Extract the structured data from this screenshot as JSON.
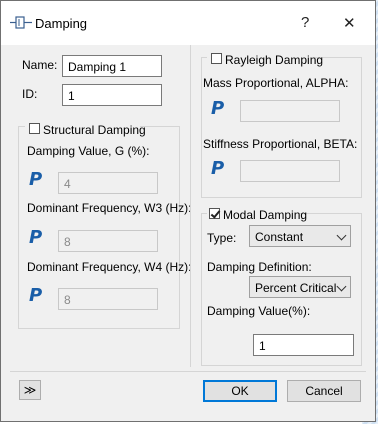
{
  "window": {
    "title": "Damping",
    "help_label": "?",
    "close_label": "✕"
  },
  "form": {
    "name_label": "Name:",
    "name_value": "Damping 1",
    "id_label": "ID:",
    "id_value": "1"
  },
  "structural": {
    "checkbox_label": "Structural Damping",
    "checked": false,
    "damping_value_label": "Damping Value, G (%):",
    "damping_value": "4",
    "w3_label": "Dominant Frequency, W3 (Hz):",
    "w3_value": "8",
    "w4_label": "Dominant Frequency, W4 (Hz):",
    "w4_value": "8",
    "param_icon_glyph": "P"
  },
  "rayleigh": {
    "checkbox_label": "Rayleigh Damping",
    "checked": false,
    "mass_label": "Mass Proportional, ALPHA:",
    "mass_value": "",
    "stiffness_label": "Stiffness Proportional, BETA:",
    "stiffness_value": "",
    "param_icon_glyph": "P"
  },
  "modal": {
    "checkbox_label": "Modal Damping",
    "checked": true,
    "type_label": "Type:",
    "type_value": "Constant",
    "definition_label": "Damping Definition:",
    "definition_value": "Percent Critical",
    "value_label": "Damping Value(%):",
    "value": "1"
  },
  "footer": {
    "expand_glyph": "≫",
    "ok_label": "OK",
    "cancel_label": "Cancel"
  },
  "colors": {
    "param_icon": "#1a5ea8",
    "primary_border": "#0078d7"
  },
  "icons": [
    "damping-window-icon",
    "help-icon",
    "close-icon",
    "parameter-icon",
    "chevron-down-icon",
    "expand-icon"
  ]
}
